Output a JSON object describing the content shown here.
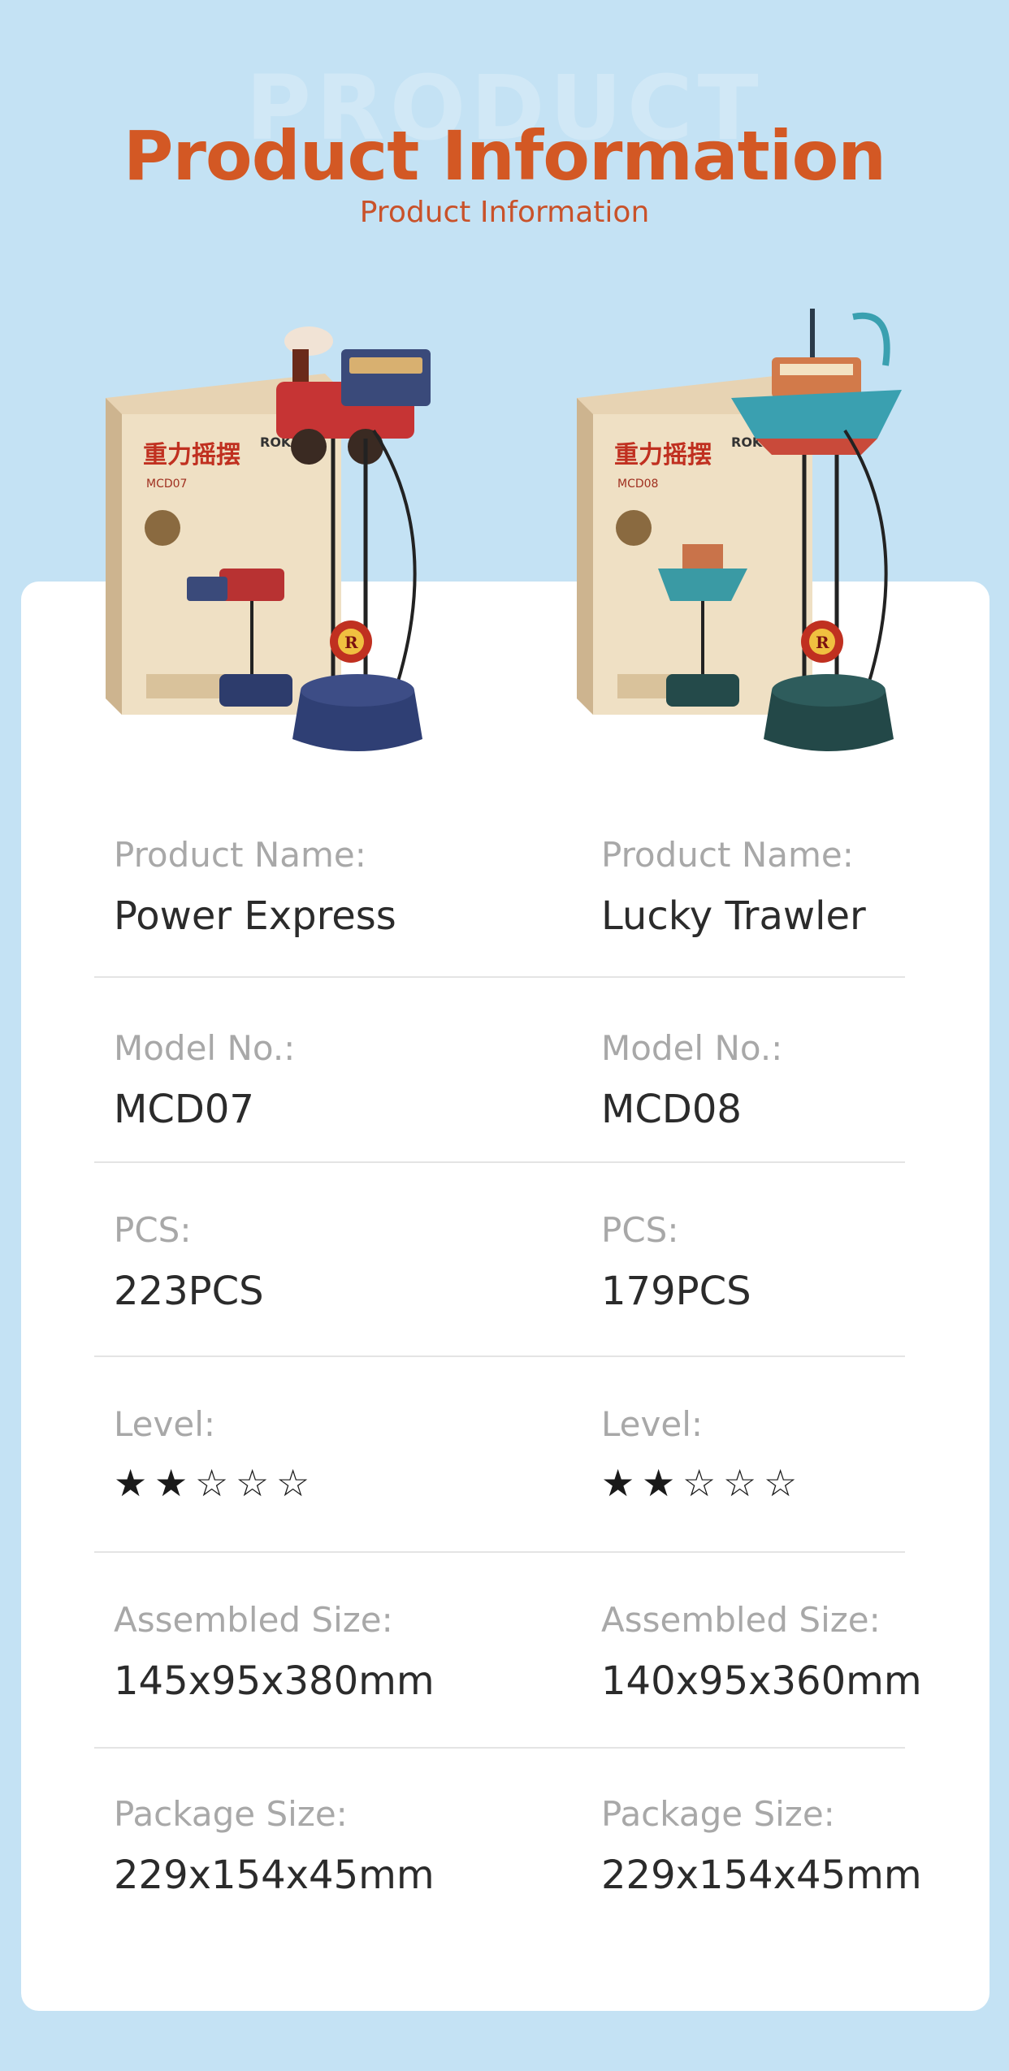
{
  "header": {
    "watermark": "PRODUCT",
    "title": "Product Information",
    "subtitle": "Product Information"
  },
  "colors": {
    "background": "#c4e2f4",
    "title": "#d35824",
    "card": "#ffffff",
    "label": "#a8a8a8",
    "value": "#2b2b2b"
  },
  "products": [
    {
      "image_icon": "train-pendulum-kit-image",
      "box_text": "重力摇摆",
      "box_code": "MCD07",
      "brand": "ROKR",
      "name_label": "Product Name:",
      "name": "Power Express",
      "model_label": "Model No.:",
      "model": "MCD07",
      "pcs_label": "PCS:",
      "pcs": "223PCS",
      "level_label": "Level:",
      "level": 2,
      "level_max": 5,
      "assembled_label": "Assembled Size:",
      "assembled": "145x95x380mm",
      "package_label": "Package Size:",
      "package": "229x154x45mm"
    },
    {
      "image_icon": "boat-pendulum-kit-image",
      "box_text": "重力摇摆",
      "box_code": "MCD08",
      "brand": "ROKR",
      "name_label": "Product Name:",
      "name": "Lucky Trawler",
      "model_label": "Model No.:",
      "model": "MCD08",
      "pcs_label": "PCS:",
      "pcs": "179PCS",
      "level_label": "Level:",
      "level": 2,
      "level_max": 5,
      "assembled_label": "Assembled Size:",
      "assembled": "140x95x360mm",
      "package_label": "Package Size:",
      "package": "229x154x45mm"
    }
  ]
}
